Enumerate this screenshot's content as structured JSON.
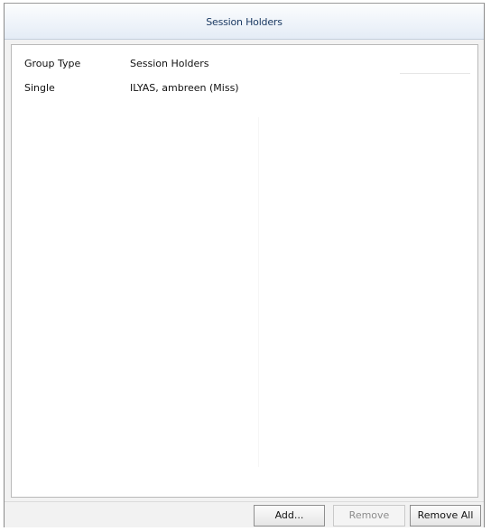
{
  "window": {
    "title": "Session Holders"
  },
  "list": {
    "columns": [
      "Group Type",
      "Session Holders"
    ],
    "rows": [
      {
        "group_type": "Single",
        "session_holders": "ILYAS, ambreen (Miss)"
      }
    ]
  },
  "buttons": {
    "add": "Add...",
    "remove": "Remove",
    "remove_all": "Remove All"
  }
}
